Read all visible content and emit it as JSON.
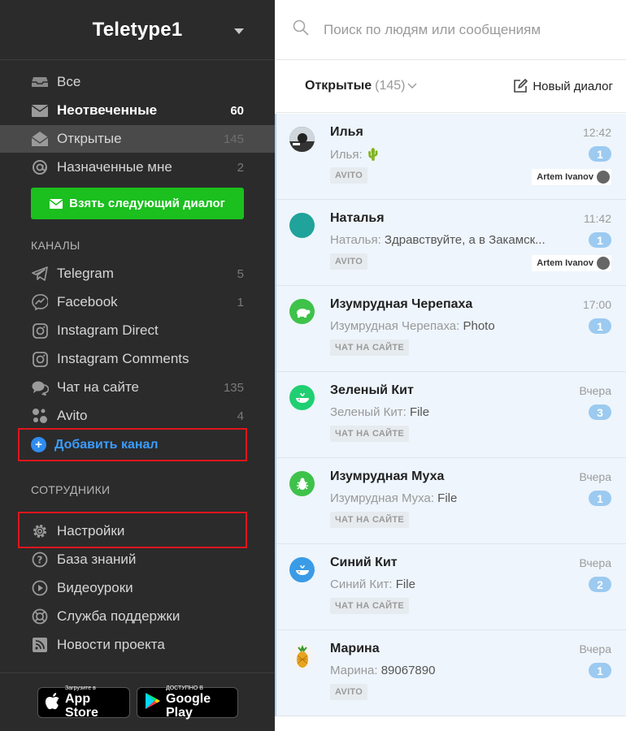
{
  "brand": {
    "name": "Teletype1"
  },
  "nav": {
    "items": [
      {
        "label": "Все",
        "count": "",
        "icon": "inbox-icon"
      },
      {
        "label": "Неотвеченные",
        "count": "60",
        "icon": "envelope-icon"
      },
      {
        "label": "Открытые",
        "count": "145",
        "icon": "open-envelope-icon"
      },
      {
        "label": "Назначенные мне",
        "count": "2",
        "icon": "at-icon"
      }
    ],
    "take_button": "Взять следующий диалог"
  },
  "channels": {
    "title": "КАНАЛЫ",
    "items": [
      {
        "label": "Telegram",
        "count": "5",
        "icon": "telegram-icon"
      },
      {
        "label": "Facebook",
        "count": "1",
        "icon": "messenger-icon"
      },
      {
        "label": "Instagram Direct",
        "count": "",
        "icon": "instagram-icon"
      },
      {
        "label": "Instagram Comments",
        "count": "",
        "icon": "instagram-icon"
      },
      {
        "label": "Чат на сайте",
        "count": "135",
        "icon": "chat-icon"
      },
      {
        "label": "Avito",
        "count": "4",
        "icon": "avito-icon"
      }
    ],
    "add_label": "Добавить канал"
  },
  "staff": {
    "title": "СОТРУДНИКИ"
  },
  "links": {
    "items": [
      {
        "label": "Настройки",
        "icon": "gear-icon"
      },
      {
        "label": "База знаний",
        "icon": "question-icon"
      },
      {
        "label": "Видеоуроки",
        "icon": "play-icon"
      },
      {
        "label": "Служба поддержки",
        "icon": "lifebuoy-icon"
      },
      {
        "label": "Новости проекта",
        "icon": "rss-icon"
      }
    ]
  },
  "stores": {
    "appstore_small": "Загрузите в",
    "appstore_big": "App Store",
    "googleplay_small": "ДОСТУПНО В",
    "googleplay_big": "Google Play"
  },
  "search": {
    "placeholder": "Поиск по людям или сообщениям"
  },
  "toolbar": {
    "filter_label": "Открытые",
    "filter_count": "(145)",
    "new_dialog": "Новый диалог"
  },
  "colors": {
    "accent_green": "#1bbf1e",
    "accent_blue": "#2f8cf0",
    "highlight_red": "#e0151c",
    "badge": "#9ccaf0"
  },
  "conversations": [
    {
      "name": "Илья",
      "time": "12:42",
      "sender": "Илья:",
      "message": "🌵",
      "badge": "1",
      "tag": "AVITO",
      "assignee": "Artem Ivanov",
      "avatar": "photo-avatar",
      "avatar_color": "#333333"
    },
    {
      "name": "Наталья",
      "time": "11:42",
      "sender": "Наталья:",
      "message": "Здравствуйте, а в Закамск...",
      "badge": "1",
      "tag": "AVITO",
      "assignee": "Artem Ivanov",
      "avatar": "teal-avatar",
      "avatar_color": "#1fa39a"
    },
    {
      "name": "Изумрудная Черепаха",
      "time": "17:00",
      "sender": "Изумрудная Черепаха:",
      "message": "Photo",
      "badge": "1",
      "tag": "ЧАТ НА САЙТЕ",
      "assignee": "",
      "avatar": "turtle-icon",
      "avatar_color": "#3ec24a"
    },
    {
      "name": "Зеленый Кит",
      "time": "Вчера",
      "sender": "Зеленый Кит:",
      "message": "File",
      "badge": "3",
      "tag": "ЧАТ НА САЙТЕ",
      "assignee": "",
      "avatar": "whale-icon",
      "avatar_color": "#1fcf72"
    },
    {
      "name": "Изумрудная Муха",
      "time": "Вчера",
      "sender": "Изумрудная Муха:",
      "message": "File",
      "badge": "1",
      "tag": "ЧАТ НА САЙТЕ",
      "assignee": "",
      "avatar": "bug-icon",
      "avatar_color": "#3ec24a"
    },
    {
      "name": "Синий Кит",
      "time": "Вчера",
      "sender": "Синий Кит:",
      "message": "File",
      "badge": "2",
      "tag": "ЧАТ НА САЙТЕ",
      "assignee": "",
      "avatar": "whale-icon",
      "avatar_color": "#3a9be6"
    },
    {
      "name": "Марина",
      "time": "Вчера",
      "sender": "Марина:",
      "message": "89067890",
      "badge": "1",
      "tag": "AVITO",
      "assignee": "",
      "avatar": "pineapple-icon",
      "avatar_color": "#f4f4f4"
    }
  ]
}
